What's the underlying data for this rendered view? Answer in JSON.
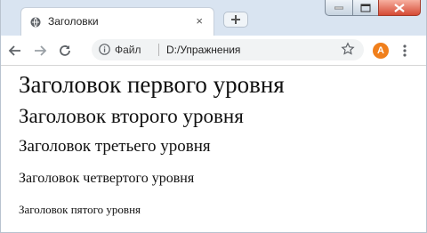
{
  "tab": {
    "title": "Заголовки",
    "close": "×"
  },
  "address": {
    "scheme_label": "Файл",
    "url": "D:/Упражнения"
  },
  "profile": {
    "initial": "A",
    "color": "#f07f1c"
  },
  "icons": {
    "tab_favicon": "globe-icon",
    "back": "back-arrow-icon",
    "forward": "forward-arrow-icon",
    "reload": "reload-icon",
    "info": "info-icon",
    "bookmark": "star-icon",
    "menu": "kebab-menu-icon",
    "new_tab": "plus-icon"
  },
  "headings": [
    "Заголовок первого уровня",
    "Заголовок второго уровня",
    "Заголовок третьего уровня",
    "Заголовок четвертого уровня",
    "Заголовок пятого уровня"
  ]
}
